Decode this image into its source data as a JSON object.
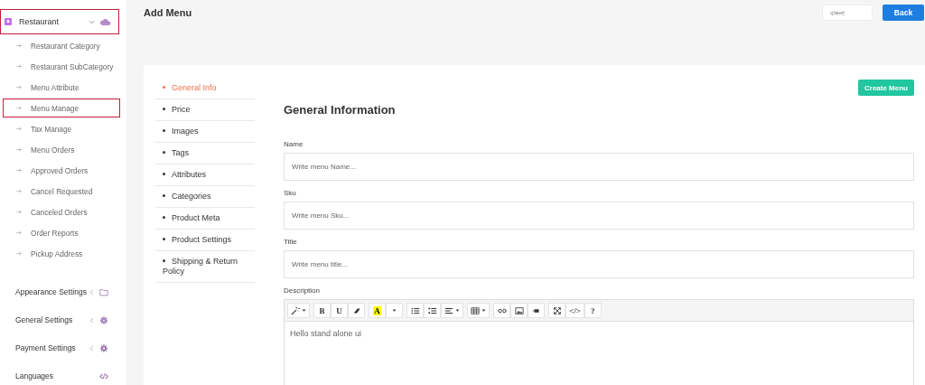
{
  "sidebar": {
    "section": {
      "label": "Restaurant",
      "expanded": true,
      "outlined": true
    },
    "items": [
      {
        "label": "Restaurant Category",
        "outlined": false
      },
      {
        "label": "Restaurant SubCategory",
        "outlined": false
      },
      {
        "label": "Menu Attribute",
        "outlined": false
      },
      {
        "label": "Menu Manage",
        "outlined": true
      },
      {
        "label": "Tax Manage",
        "outlined": false
      },
      {
        "label": "Menu Orders",
        "outlined": false
      },
      {
        "label": "Approved Orders",
        "outlined": false
      },
      {
        "label": "Cancel Requested",
        "outlined": false
      },
      {
        "label": "Canceled Orders",
        "outlined": false
      },
      {
        "label": "Order Reports",
        "outlined": false
      },
      {
        "label": "Pickup Address",
        "outlined": false
      }
    ],
    "groups": [
      {
        "label": "Appearance Settings",
        "kind": "folder",
        "collapsible": true
      },
      {
        "label": "General Settings",
        "kind": "gear",
        "collapsible": true
      },
      {
        "label": "Payment Settings",
        "kind": "gear",
        "collapsible": true
      },
      {
        "label": "Languages",
        "kind": "code",
        "collapsible": false
      }
    ]
  },
  "header": {
    "title": "Add Menu",
    "language_field": {
      "placeholder": "বাংলা"
    },
    "back_button": "Back"
  },
  "tabs": [
    {
      "label": "General Info",
      "selected": true
    },
    {
      "label": "Price",
      "selected": false
    },
    {
      "label": "Images",
      "selected": false
    },
    {
      "label": "Tags",
      "selected": false
    },
    {
      "label": "Attributes",
      "selected": false
    },
    {
      "label": "Categories",
      "selected": false
    },
    {
      "label": "Product Meta",
      "selected": false
    },
    {
      "label": "Product Settings",
      "selected": false
    },
    {
      "label": "Shipping & Return Policy",
      "selected": false
    }
  ],
  "create_button": "Create Menu",
  "form": {
    "heading": "General Information",
    "fields": [
      {
        "label": "Name",
        "placeholder": "Write menu Name..."
      },
      {
        "label": "Sku",
        "placeholder": "Write menu Sku..."
      },
      {
        "label": "Title",
        "placeholder": "Write menu title..."
      }
    ],
    "description": {
      "label": "Description",
      "value": "Hello stand alone ui",
      "toolbar": [
        [
          {
            "kind": "wand",
            "dropdown": true
          }
        ],
        [
          {
            "kind": "text",
            "text": "B"
          },
          {
            "kind": "text",
            "text": "U"
          },
          {
            "kind": "eraser"
          }
        ],
        [
          {
            "kind": "color",
            "text": "A"
          },
          {
            "kind": "caret"
          }
        ],
        [
          {
            "kind": "ul"
          },
          {
            "kind": "ol"
          },
          {
            "kind": "align",
            "dropdown": true
          }
        ],
        [
          {
            "kind": "table",
            "dropdown": true
          }
        ],
        [
          {
            "kind": "link"
          },
          {
            "kind": "image"
          },
          {
            "kind": "video"
          }
        ],
        [
          {
            "kind": "fullscreen"
          },
          {
            "kind": "text",
            "text": "</>"
          },
          {
            "kind": "text",
            "text": "?"
          }
        ]
      ]
    }
  }
}
